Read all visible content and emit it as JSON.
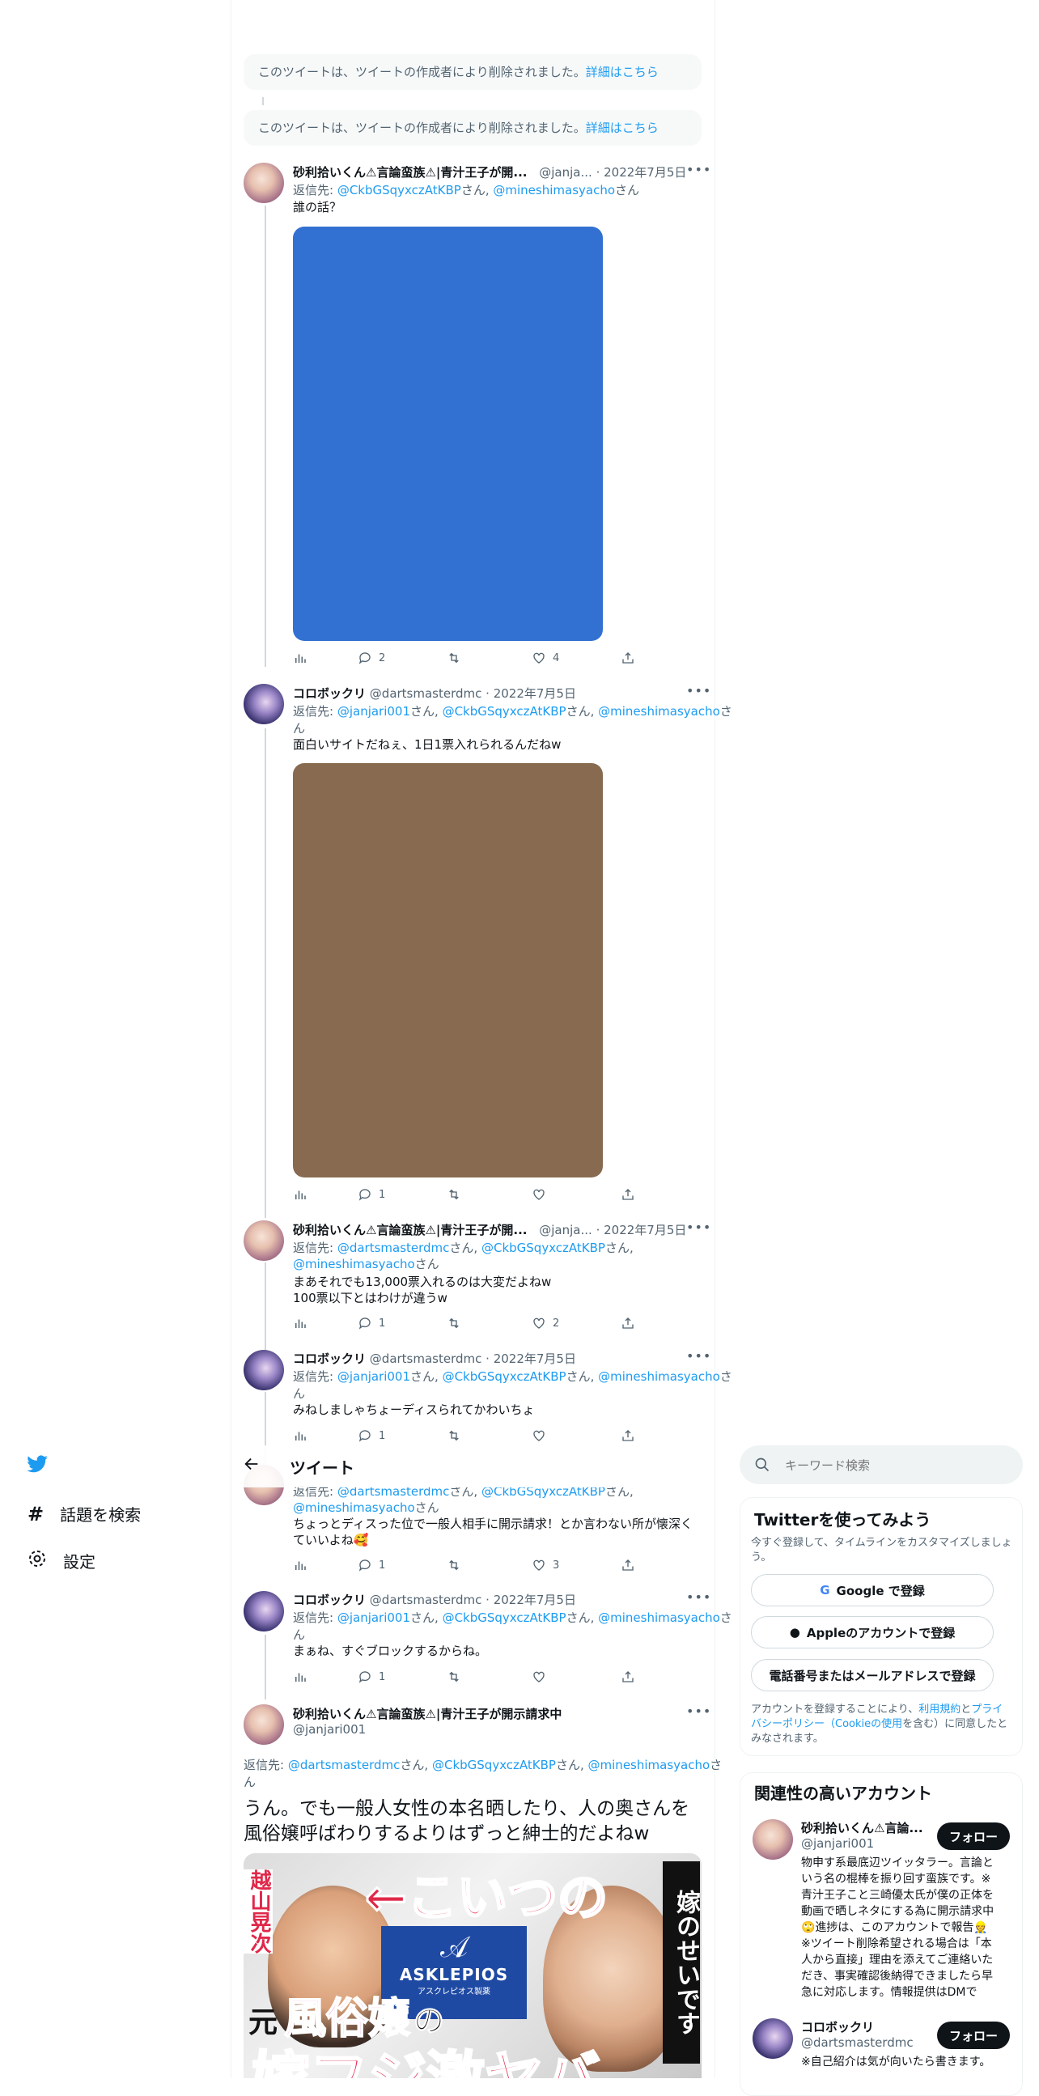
{
  "deleted_notice": {
    "text": "このツイートは、ツイートの作成者により削除されました。",
    "link": "詳細はこちら"
  },
  "header": {
    "title": "ツイート"
  },
  "left_nav": {
    "explore": "話題を検索",
    "settings": "設定"
  },
  "search": {
    "placeholder": "キーワード検索"
  },
  "tweets": [
    {
      "name": "砂利拾いくん⚠言論蛮族⚠|青汁王子が開...",
      "handle": "@janja...",
      "date": "2022年7月5日",
      "reply_to": {
        "prefix": "返信先: ",
        "h1": "@CkbGSqyxczAtKBP",
        "s1": "さん, ",
        "h2": "@mineshimasyacho",
        "s2": "さん"
      },
      "text": "誰の話？",
      "stats": {
        "replies": "2",
        "retweets": "",
        "likes": "4"
      }
    },
    {
      "name": "コロボックリ",
      "handle": "@dartsmasterdmc",
      "date": "2022年7月5日",
      "reply_to": {
        "prefix": "返信先: ",
        "h1": "@janjari001",
        "s1": "さん, ",
        "h2": "@CkbGSqyxczAtKBP",
        "s2": "さん, ",
        "h3": "@mineshimasyacho",
        "s3": "さ",
        "s3b": "ん"
      },
      "text": "面白いサイトだねぇ、1日1票入れられるんだねw",
      "stats": {
        "replies": "1",
        "retweets": "",
        "likes": ""
      }
    },
    {
      "name": "砂利拾いくん⚠言論蛮族⚠|青汁王子が開...",
      "handle": "@janja...",
      "date": "2022年7月5日",
      "reply_to": {
        "prefix": "返信先: ",
        "h1": "@dartsmasterdmc",
        "s1": "さん, ",
        "h2": "@CkbGSqyxczAtKBP",
        "s2": "さん, ",
        "h3": "@mineshimasyacho",
        "s3": "さん"
      },
      "text1": "まあそれでも13,000票入れるのは大変だよねw",
      "text2": "100票以下とはわけが違うw",
      "stats": {
        "replies": "1",
        "retweets": "",
        "likes": "2"
      }
    },
    {
      "name": "コロボックリ",
      "handle": "@dartsmasterdmc",
      "date": "2022年7月5日",
      "reply_to": {
        "prefix": "返信先: ",
        "h1": "@janjari001",
        "s1": "さん, ",
        "h2": "@CkbGSqyxczAtKBP",
        "s2": "さん, ",
        "h3": "@mineshimasyacho",
        "s3": "さ",
        "s3b": "ん"
      },
      "text": "みねしましゃちょーディスられてかわいちょ",
      "stats": {
        "replies": "1",
        "retweets": "",
        "likes": ""
      }
    },
    {
      "reply_to": {
        "h1": "@dartsmasterdmc",
        "s1": "さん, ",
        "h2": "@CkbGSqyxczAtKBP",
        "s2": "さん,",
        "h3": "@mineshimasyacho",
        "s3": "さん"
      },
      "text1": "ちょっとディスった位で一般人相手に開示請求！とか言わない所が懐深く",
      "text2": "ていいよね🥰",
      "stats": {
        "replies": "1",
        "retweets": "",
        "likes": "3"
      }
    },
    {
      "name": "コロボックリ",
      "handle": "@dartsmasterdmc",
      "date": "2022年7月5日",
      "reply_to": {
        "prefix": "返信先: ",
        "h1": "@janjari001",
        "s1": "さん, ",
        "h2": "@CkbGSqyxczAtKBP",
        "s2": "さん, ",
        "h3": "@mineshimasyacho",
        "s3": "さ",
        "s3b": "ん"
      },
      "text": "まぁね、すぐブロックするからね。",
      "stats": {
        "replies": "1",
        "retweets": "",
        "likes": ""
      }
    }
  ],
  "main_tweet": {
    "name": "砂利拾いくん⚠言論蛮族⚠|青汁王子が開示請求中",
    "handle": "@janjari001",
    "reply_to": {
      "prefix": "返信先: ",
      "h1": "@dartsmasterdmc",
      "s1": "さん, ",
      "h2": "@CkbGSqyxczAtKBP",
      "s2": "さん, ",
      "h3": "@mineshimasyacho",
      "s3": "さ",
      "s3b": "ん"
    },
    "text1": "うん。でも一般人女性の本名晒したり、人の奥さんを",
    "text2": "風俗嬢呼ばわりするよりはずっと紳士的だよねw",
    "image": {
      "left_name": "越山晃次",
      "top_text": "←こいつの",
      "right_text": "嫁のせいです",
      "logo": "ASKLEPIOS",
      "logo_sub": "アスクレピオス製薬",
      "moto": "元",
      "fuzoku": "風俗嬢",
      "no": "の",
      "bottom": "嫁フジ激ヤバ"
    }
  },
  "signup": {
    "title": "Twitterを使ってみよう",
    "subtitle1": "今すぐ登録して、タイムラインをカスタマイズしましょ",
    "subtitle2": "う。",
    "google": "Google で登録",
    "apple": "Appleのアカウントで登録",
    "phone": "電話番号またはメールアドレスで登録",
    "terms1a": "アカウントを登録することにより、",
    "terms_link1": "利用規約",
    "terms1b": "と",
    "terms_link2": "プライ",
    "terms_link2b": "バシーポリシー（Cookieの使用",
    "terms2b": "を含む）に同意したと",
    "terms3": "みなされます。"
  },
  "related": {
    "title": "関連性の高いアカウント",
    "follow": "フォロー",
    "accounts": [
      {
        "name": "砂利拾いくん⚠言論...",
        "handle": "@janjari001",
        "bio": [
          "物申す系最底辺ツイッタラー。言論と",
          "いう名の棍棒を振り回す蛮族です。※",
          "青汁王子こと三崎優太氏が僕の正体を",
          "動画で晒しネタにする為に開示請求中",
          "🙄進捗は、このアカウントで報告👷",
          "※ツイート削除希望される場合は「本",
          "人から直接」理由を添えてご連絡いた",
          "だき、事実確認後納得できましたら早",
          "急に対応します。情報提供はDMで"
        ]
      },
      {
        "name": "コロボックリ",
        "handle": "@dartsmasterdmc",
        "bio": [
          "※自己紹介は気が向いたら書きます。"
        ]
      }
    ]
  },
  "colors": {
    "accent": "#1d9bf0",
    "text": "#0f1419",
    "muted": "#536471",
    "media1": "#3271d2",
    "media2": "#876a50"
  }
}
